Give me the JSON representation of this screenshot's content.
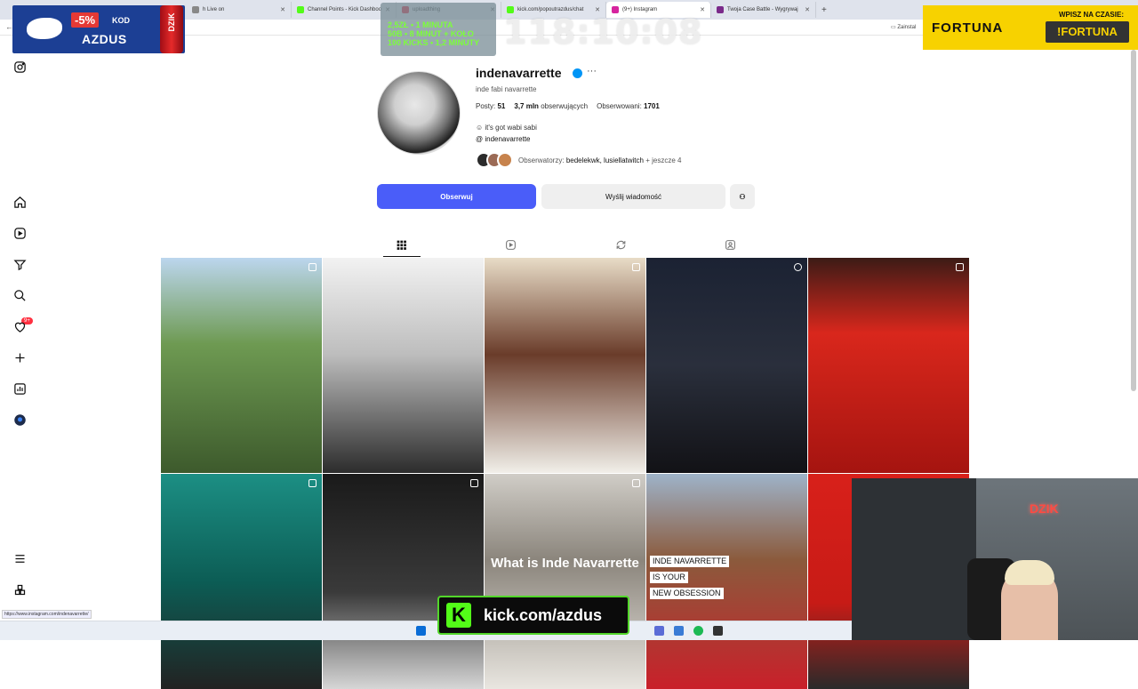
{
  "browser": {
    "tabs": [
      {
        "label": "h Live on",
        "color": "#888888"
      },
      {
        "label": "Channel Points - Kick Dashboo",
        "color": "#53fc18"
      },
      {
        "label": "uploadthing",
        "color": "#e0203a"
      },
      {
        "label": "kick.com/popoutrazdus/chat",
        "color": "#53fc18"
      },
      {
        "label": "(9+) Instagram",
        "color": "#d6249f",
        "active": true
      },
      {
        "label": "Twoja Case Battle - Wygrywaj",
        "color": "#7a2a8a"
      }
    ],
    "install_label": "Zainstal",
    "status_url": "https://www.instagram.com/indenavarrette/"
  },
  "overlays": {
    "promo": {
      "discount": "-5%",
      "kod": "KOD",
      "code": "AZDUS",
      "can_text": "DZIK"
    },
    "rates": [
      "2,5ZŁ • 1 MINUTA",
      "50B • 8 MINUT + KOŁO",
      "100 KICKS • 1,2 MINUTY"
    ],
    "timer": "118:10:08",
    "fortuna": {
      "brand": "FORTUNA",
      "label": "WPISZ NA CZASIE:",
      "code": "!FORTUNA"
    },
    "kick": {
      "k": "K",
      "url": "kick.com/azdus"
    },
    "cam": {
      "neon": "DZIK"
    }
  },
  "sidebar": {
    "icons": [
      "instagram-logo-icon",
      "home-icon",
      "reels-icon",
      "explore-icon",
      "search-icon",
      "heart-icon",
      "create-icon",
      "dashboard-icon",
      "profile-icon",
      "menu-icon",
      "apps-icon"
    ],
    "notification_badge": "9+"
  },
  "profile": {
    "username": "indenavarrette",
    "full_name": "inde fabi navarrette",
    "posts_label": "Posty:",
    "posts": "51",
    "followers": "3,7 mln",
    "followers_label": "obserwujących",
    "following_label": "Obserwowani:",
    "following": "1701",
    "bio": "it's got wabi sabi",
    "threads_handle": "indenavarrette",
    "followed_by_label": "Obserwatorzy:",
    "followed_by": "bedelekwk, lusiellatwitch",
    "followed_by_more": "+ jeszcze 4",
    "follow_button": "Obserwuj",
    "message_button": "Wyślij wiadomość"
  },
  "posts": [
    {
      "bg": "linear-gradient(180deg,#bcd6ee 0,#6e9a52 40%,#3d5a2c 100%)",
      "type": "carousel"
    },
    {
      "bg": "linear-gradient(180deg,#f2f2f2 0,#bdbdbd 45%,#2c2c2c 100%)",
      "type": "none"
    },
    {
      "bg": "linear-gradient(180deg,#e8dcc7 0,#6a3c2a 45%,#f1efe9 100%)",
      "type": "carousel"
    },
    {
      "bg": "linear-gradient(180deg,#1b2233 0,#2a2f3c 50%,#121216 100%)",
      "type": "reel"
    },
    {
      "bg": "linear-gradient(180deg,#3c1b16 0,#d9271c 35%,#a51410 100%)",
      "type": "carousel"
    },
    {
      "bg": "linear-gradient(180deg,#1c8f84 0,#0c5d55 50%,#222 100%)",
      "type": "carousel"
    },
    {
      "bg": "linear-gradient(180deg,#1a1a1a 0,#3a3a3a 55%,#d6d6d6 100%)",
      "type": "carousel"
    },
    {
      "bg": "linear-gradient(180deg,#d0cdc7 0,#8b857c 40%,#e9e6e0 100%)",
      "type": "carousel",
      "caption": "What is Inde Navarrette"
    },
    {
      "bg": "linear-gradient(180deg,#9eb3c9 0,#8b5a3c 40%,#c9202a 100%)",
      "type": "none",
      "caption_lines": [
        "INDE NAVARRETTE",
        "IS YOUR",
        "NEW OBSESSION"
      ]
    },
    {
      "bg": "linear-gradient(180deg,#d8201a 0,#c71b16 60%,#2a2a2a 100%)",
      "type": "none"
    }
  ]
}
